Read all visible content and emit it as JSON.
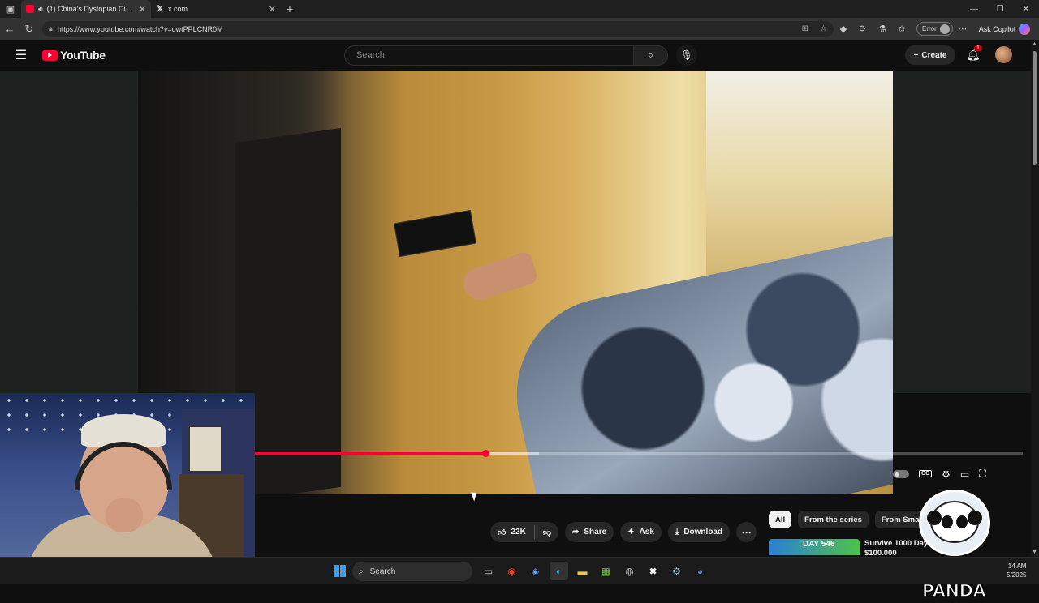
{
  "browser": {
    "tabs": [
      {
        "title": "(1) China's Dystopian City in",
        "active": true,
        "icon": "youtube-favicon"
      },
      {
        "title": "x.com",
        "active": false,
        "icon": "x-favicon"
      }
    ],
    "url": "https://www.youtube.com/watch?v=owtPPLCNR0M",
    "error_badge": "Error",
    "copilot_label": "Ask Copilot"
  },
  "youtube": {
    "logo_text": "YouTube",
    "search_placeholder": "Search",
    "create_label": "Create",
    "notification_count": "1"
  },
  "player": {
    "played_fraction": 0.3,
    "loaded_fraction": 0.37
  },
  "actions": {
    "like_count": "22K",
    "share_label": "Share",
    "ask_label": "Ask",
    "download_label": "Download"
  },
  "chips": [
    "All",
    "From the series",
    "From Small Bu"
  ],
  "recommended": {
    "thumb_text": "DAY 546",
    "title_line1": "Survive 1000 Day",
    "title_line2": "$100,000"
  },
  "overlay": {
    "panda_text": "SPACE PANDA"
  },
  "taskbar": {
    "search_label": "Search",
    "time": "14 AM",
    "date": "5/2025"
  },
  "colors": {
    "accent_red": "#ff0033",
    "bg": "#0f0f0f",
    "windows_blue": "#3aa0ff"
  }
}
